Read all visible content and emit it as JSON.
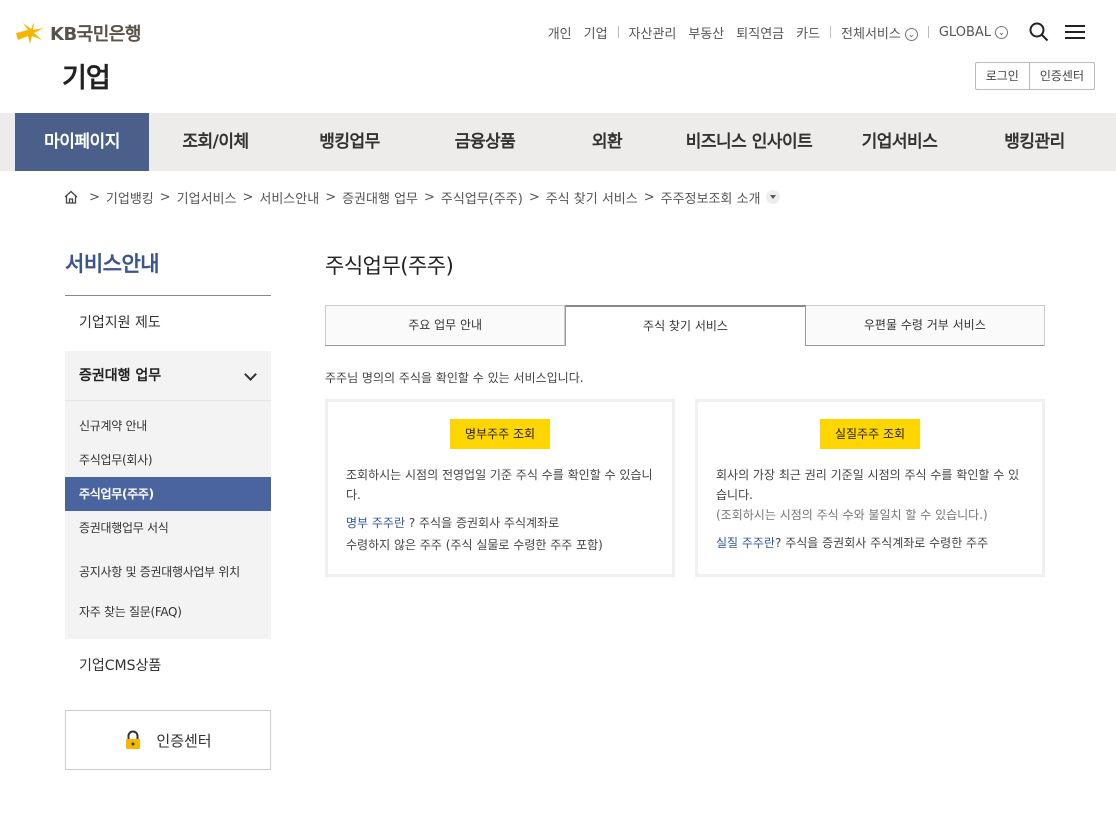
{
  "brand": {
    "logo_text": "KB국민은행",
    "site_title": "기업"
  },
  "util_nav": {
    "items_left": [
      "개인",
      "기업"
    ],
    "items_mid": [
      "자산관리",
      "부동산",
      "퇴직연금",
      "카드"
    ],
    "all_services": "전체서비스",
    "global": "GLOBAL",
    "login": "로그인",
    "cert_center": "인증센터"
  },
  "gnb": [
    "마이페이지",
    "조회/이체",
    "뱅킹업무",
    "금융상품",
    "외환",
    "비즈니스 인사이트",
    "기업서비스",
    "뱅킹관리"
  ],
  "breadcrumb": [
    "기업뱅킹",
    "기업서비스",
    "서비스안내",
    "증권대행 업무",
    "주식업무(주주)",
    "주식 찾기 서비스",
    "주주정보조회 소개"
  ],
  "lnb": {
    "title": "서비스안내",
    "item1": "기업지원 제도",
    "group": "증권대행 업무",
    "sub": [
      "신규계약 안내",
      "주식업무(회사)",
      "주식업무(주주)",
      "증권대행업무 서식",
      "공지사항 및 증권대행사업부 위치",
      "자주 찾는 질문(FAQ)"
    ],
    "item2": "기업CMS상품",
    "cert": "인증센터"
  },
  "content": {
    "title": "주식업무(주주)",
    "tabs": [
      "주요 업무 안내",
      "주식 찾기 서비스",
      "우편물 수령 거부 서비스"
    ],
    "desc": "주주님 명의의 주식을 확인할 수 있는 서비스입니다.",
    "card1": {
      "button": "명부주주 조회",
      "text": "조회하시는 시점의 전영업일 기준 주식 수를 확인할 수 있습니다.",
      "link": "명부 주주란",
      "link_rest1": " ? 주식을 증권회사 주식계좌로",
      "link_rest2": "수령하지 않은 주주 (주식 실물로 수령한 주주 포함)"
    },
    "card2": {
      "button": "실질주주 조회",
      "text": "회사의 가장 최근 권리 기준일 시점의 주식 수를 확인할 수 있습니다.",
      "note": "(조회하시는 시점의 주식 수와 불일치 할 수 있습니다.)",
      "link": "실질 주주란",
      "link_rest1": "? 주식을 증권회사 주식계좌로 수령한 주주"
    }
  },
  "colors": {
    "gnb_active": "#4a5f8a",
    "lnb_title": "#3a5590",
    "yellow": "#ffd600",
    "link": "#2f55a4"
  }
}
